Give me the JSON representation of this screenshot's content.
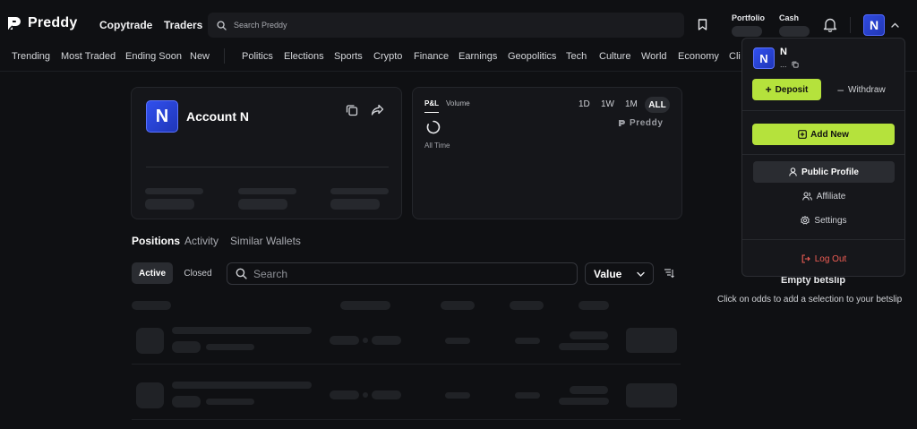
{
  "brand": {
    "name": "Preddy"
  },
  "nav": {
    "copytrade": "Copytrade",
    "traders": "Traders"
  },
  "search": {
    "placeholder": "Search Preddy"
  },
  "header": {
    "portfolio_label": "Portfolio",
    "cash_label": "Cash",
    "avatar_initial": "N"
  },
  "categories": [
    "Trending",
    "Most Traded",
    "Ending Soon",
    "New",
    "Politics",
    "Elections",
    "Sports",
    "Crypto",
    "Finance",
    "Earnings",
    "Geopolitics",
    "Tech",
    "Culture",
    "World",
    "Economy",
    "Cli"
  ],
  "account": {
    "initial": "N",
    "name": "Account N"
  },
  "pnl": {
    "tabs": [
      "P&L",
      "Volume"
    ],
    "ranges": [
      "1D",
      "1W",
      "1M",
      "ALL"
    ],
    "active_range": "ALL",
    "period": "All Time",
    "watermark": "Preddy"
  },
  "positions": {
    "tabs": [
      "Positions",
      "Activity",
      "Similar Wallets"
    ],
    "filters": [
      "Active",
      "Closed"
    ],
    "search_placeholder": "Search",
    "sort_value": "Value"
  },
  "betslip": {
    "title": "Empty betslip",
    "subtitle": "Click on odds to add a selection to your betslip"
  },
  "menu": {
    "initial": "N",
    "name": "N",
    "address": "...",
    "deposit": "Deposit",
    "withdraw": "Withdraw",
    "add_new": "Add New",
    "public_profile": "Public Profile",
    "affiliate": "Affiliate",
    "settings": "Settings",
    "logout": "Log Out"
  },
  "colors": {
    "accent": "#b5e23c",
    "avatar": "#2f4ae0",
    "danger": "#ef5d54",
    "background": "#0f1013"
  }
}
